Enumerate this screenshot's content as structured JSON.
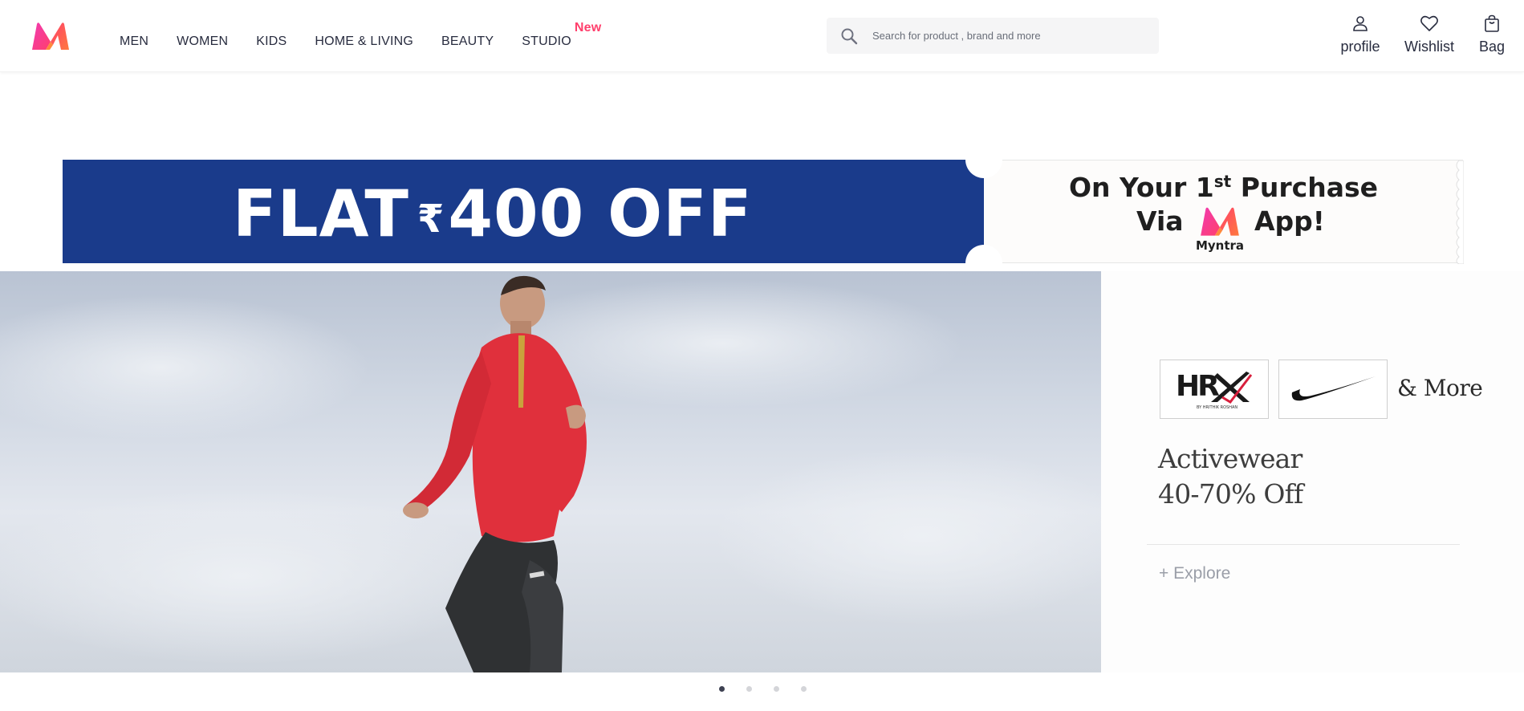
{
  "brand": {
    "logo_icon": "myntra-logo-icon"
  },
  "nav": {
    "items": [
      {
        "label": "MEN"
      },
      {
        "label": "WOMEN"
      },
      {
        "label": "KIDS"
      },
      {
        "label": "HOME & LIVING"
      },
      {
        "label": "BEAUTY"
      },
      {
        "label": "STUDIO",
        "badge": "New"
      }
    ]
  },
  "search": {
    "placeholder": "Search for product , brand and more",
    "value": "",
    "icon": "search-icon"
  },
  "actions": {
    "profile": {
      "label": "profile",
      "icon": "profile-icon"
    },
    "wishlist": {
      "label": "Wishlist",
      "icon": "heart-icon"
    },
    "bag": {
      "label": "Bag",
      "icon": "bag-icon"
    }
  },
  "offer": {
    "flat_text": "FLAT",
    "rupee_symbol": "₹",
    "amount_text": "400 OFF",
    "line1_pre": "On Your 1",
    "line1_sup": "st",
    "line1_post": " Purchase",
    "line2_pre": "Via",
    "line2_post": "App!",
    "logo_text": "Myntra",
    "left_color": "#1a3b8b"
  },
  "hero": {
    "brands": [
      {
        "name": "HRX",
        "tagline": "BY HRITHIK ROSHAN"
      },
      {
        "name": "Nike",
        "icon": "nike-swoosh-icon"
      }
    ],
    "more": "& More",
    "title": "Activewear",
    "subtitle": "40-70% Off",
    "explore": "+ Explore"
  },
  "carousel": {
    "count": 4,
    "active": 0
  },
  "colors": {
    "accent": "#ff3f6c",
    "text": "#282c3f"
  }
}
